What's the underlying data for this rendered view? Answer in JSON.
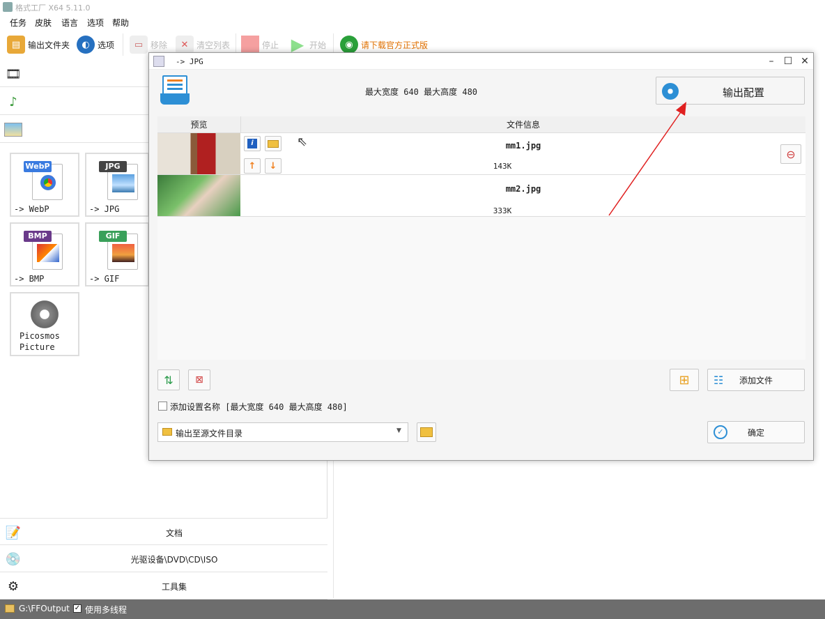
{
  "window": {
    "title": "格式工厂 X64 5.11.0"
  },
  "menu": [
    "任务",
    "皮肤",
    "语言",
    "选项",
    "帮助"
  ],
  "toolbar": {
    "output_folder": "输出文件夹",
    "options": "选项",
    "remove": "移除",
    "clear_list": "清空列表",
    "stop": "停止",
    "start": "开始",
    "download_official": "请下载官方正式版"
  },
  "left_panel": {
    "formats": [
      {
        "badge": "WebP",
        "label": "-> WebP",
        "color": "#3a7be0"
      },
      {
        "badge": "JPG",
        "label": "-> JPG",
        "color": "#444444"
      },
      {
        "badge": "BMP",
        "label": "-> BMP",
        "color": "#6a3a8a"
      },
      {
        "badge": "GIF",
        "label": "-> GIF",
        "color": "#3aa05a"
      }
    ],
    "picosmos_line1": "Picosmos",
    "picosmos_line2": "Picture",
    "bottom_categories": [
      "文档",
      "光驱设备\\DVD\\CD\\ISO",
      "工具集"
    ]
  },
  "dialog": {
    "title": "-> JPG",
    "max_size_info": "最大宽度 640 最大高度 480",
    "output_config": "输出配置",
    "col_preview": "预览",
    "col_file_info": "文件信息",
    "files": [
      {
        "name": "mm1.jpg",
        "size": "143K"
      },
      {
        "name": "mm2.jpg",
        "size": "333K"
      }
    ],
    "add_setting_name": "添加设置名称 [最大宽度 640 最大高度 480]",
    "add_file": "添加文件",
    "output_dir": "输出至源文件目录",
    "ok": "确定"
  },
  "status": {
    "path": "G:\\FFOutput",
    "multithread": "使用多线程"
  },
  "colors": {
    "accent": "#2d8fd5",
    "arrow": "#e02020",
    "status_bg": "#6d6d6d"
  }
}
